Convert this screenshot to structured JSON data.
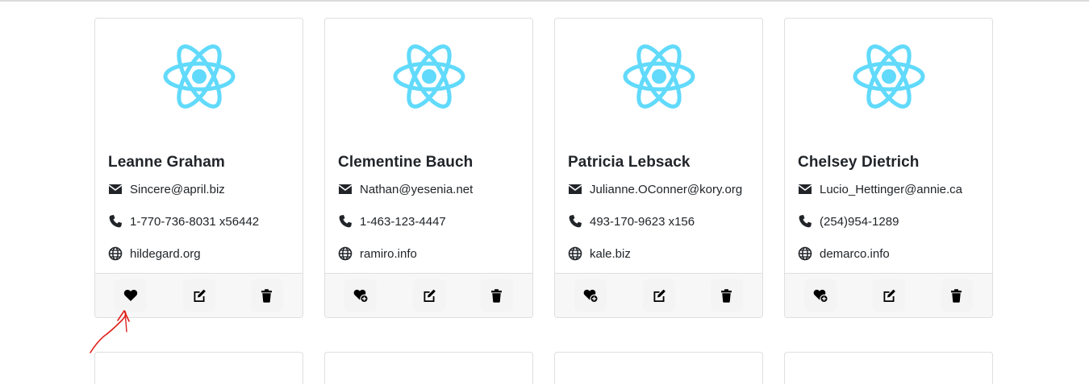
{
  "cards": [
    {
      "name": "Leanne Graham",
      "email": "Sincere@april.biz",
      "phone": "1-770-736-8031 x56442",
      "website": "hildegard.org",
      "favorite_icon": "heart-filled-icon"
    },
    {
      "name": "Clementine Bauch",
      "email": "Nathan@yesenia.net",
      "phone": "1-463-123-4447",
      "website": "ramiro.info",
      "favorite_icon": "heart-plus-icon"
    },
    {
      "name": "Patricia Lebsack",
      "email": "Julianne.OConner@kory.org",
      "phone": "493-170-9623 x156",
      "website": "kale.biz",
      "favorite_icon": "heart-plus-icon"
    },
    {
      "name": "Chelsey Dietrich",
      "email": "Lucio_Hettinger@annie.ca",
      "phone": "(254)954-1289",
      "website": "demarco.info",
      "favorite_icon": "heart-plus-icon"
    }
  ],
  "icons": {
    "logo": "react-logo-icon",
    "email": "envelope-icon",
    "phone": "phone-icon",
    "website": "globe-icon",
    "edit": "edit-icon",
    "delete": "trash-icon"
  },
  "colors": {
    "react_blue": "#61dafb",
    "annotation_red": "#e0201b",
    "footer_bg": "#f7f7f7"
  }
}
